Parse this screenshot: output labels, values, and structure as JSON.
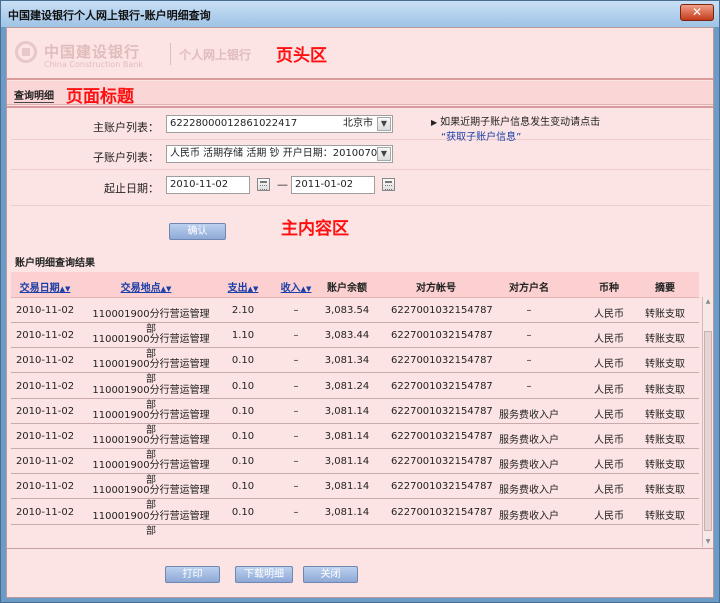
{
  "window": {
    "title": "中国建设银行个人网上银行-账户明细查询",
    "close_glyph": "✕"
  },
  "header": {
    "logo_cn": "中国建设银行",
    "logo_en": "China Construction Bank",
    "logo_sub": "个人网上银行",
    "annotation": "页头区"
  },
  "pagebar": {
    "crumb": "查询明细",
    "annotation": "页面标题"
  },
  "form": {
    "main_account_label": "主账户列表：",
    "main_account_value": "6222800001286102241​7",
    "main_account_city": "北京市",
    "sub_account_label": "子账户列表：",
    "sub_account_value": "人民币 活期存储 活期 钞 开户日期：20100707",
    "date_label": "起止日期：",
    "date_start": "2010-11-02",
    "date_sep": "—",
    "date_end": "2011-01-02",
    "hint": "如果近期子账户信息发生变动请点击",
    "hint_link": "“获取子账户信息”",
    "confirm": "确认",
    "annotation": "主内容区"
  },
  "results": {
    "title": "账户明细查询结果",
    "columns": [
      "交易日期",
      "交易地点",
      "支出",
      "收入",
      "账户余额",
      "对方帐号",
      "对方户名",
      "币种",
      "摘要"
    ],
    "sort_glyph": "▲▼",
    "rows": [
      [
        "2010-11-02",
        "110001900分行营运管理部",
        "2.10",
        "–",
        "3,083.54",
        "6227001032154787",
        "–",
        "人民币",
        "转账支取"
      ],
      [
        "2010-11-02",
        "110001900分行营运管理部",
        "1.10",
        "–",
        "3,083.44",
        "6227001032154787",
        "–",
        "人民币",
        "转账支取"
      ],
      [
        "2010-11-02",
        "110001900分行营运管理部",
        "0.10",
        "–",
        "3,081.34",
        "6227001032154787",
        "–",
        "人民币",
        "转账支取"
      ],
      [
        "2010-11-02",
        "110001900分行营运管理部",
        "0.10",
        "–",
        "3,081.24",
        "6227001032154787",
        "–",
        "人民币",
        "转账支取"
      ],
      [
        "2010-11-02",
        "110001900分行营运管理部",
        "0.10",
        "–",
        "3,081.14",
        "6227001032154787",
        "服务费收入户",
        "人民币",
        "转账支取"
      ],
      [
        "2010-11-02",
        "110001900分行营运管理部",
        "0.10",
        "–",
        "3,081.14",
        "6227001032154787",
        "服务费收入户",
        "人民币",
        "转账支取"
      ],
      [
        "2010-11-02",
        "110001900分行营运管理部",
        "0.10",
        "–",
        "3,081.14",
        "6227001032154787",
        "服务费收入户",
        "人民币",
        "转账支取"
      ],
      [
        "2010-11-02",
        "110001900分行营运管理部",
        "0.10",
        "–",
        "3,081.14",
        "6227001032154787",
        "服务费收入户",
        "人民币",
        "转账支取"
      ],
      [
        "2010-11-02",
        "110001900分行营运管理部",
        "0.10",
        "–",
        "3,081.14",
        "6227001032154787",
        "服务费收入户",
        "人民币",
        "转账支取"
      ]
    ]
  },
  "footer": {
    "print": "打印",
    "download": "下载明细",
    "close": "关闭"
  }
}
